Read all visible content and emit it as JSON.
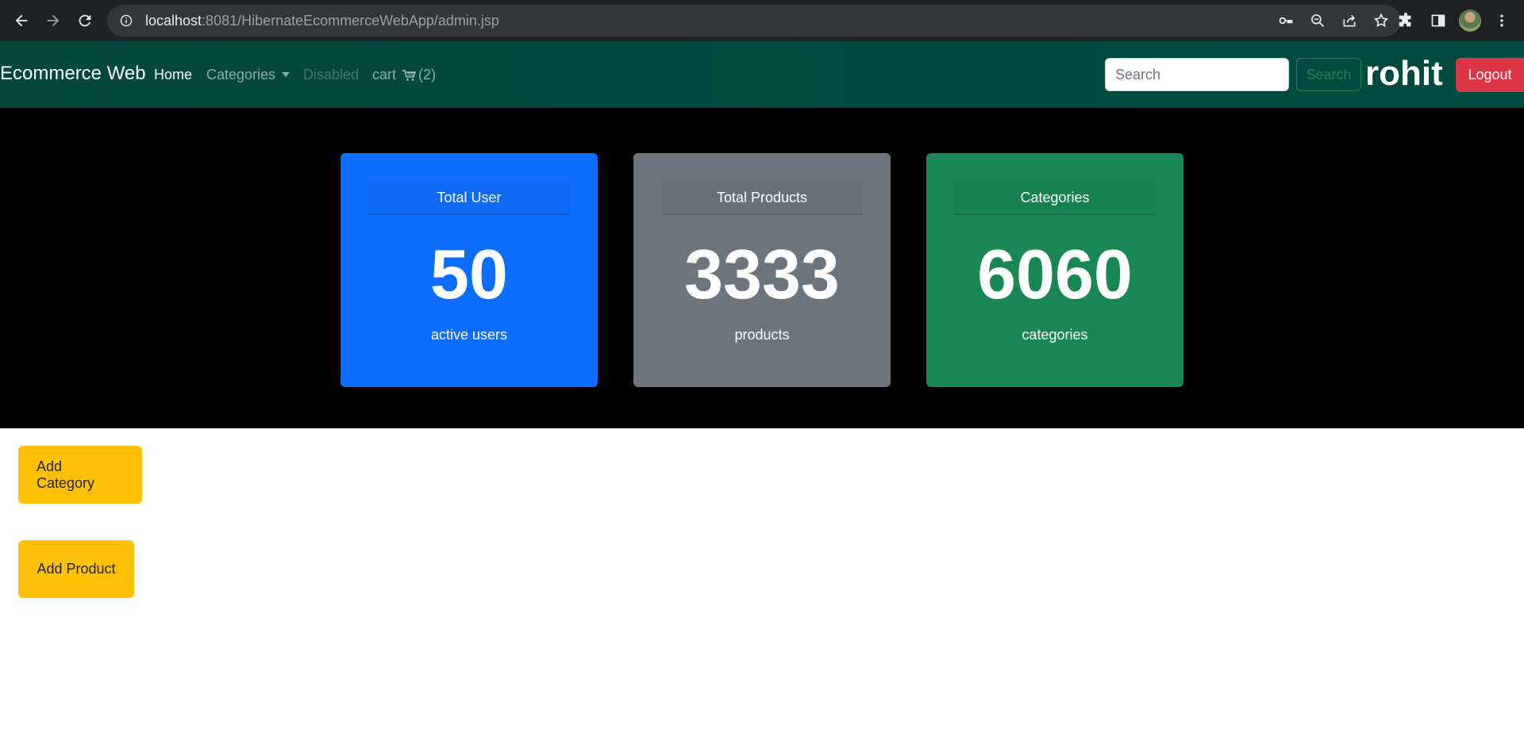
{
  "browser": {
    "url_host": "localhost",
    "url_rest": ":8081/HibernateEcommerceWebApp/admin.jsp"
  },
  "navbar": {
    "brand": "Ecommerce Web",
    "links": {
      "home": "Home",
      "categories": "Categories",
      "disabled": "Disabled",
      "cart": "cart",
      "cart_count": "(2)"
    },
    "search_placeholder": "Search",
    "search_button": "Search",
    "user_name": "rohit",
    "logout_button": "Logout"
  },
  "stats": [
    {
      "title": "Total User",
      "value": "50",
      "subtitle": "active users",
      "color": "#0d6efd"
    },
    {
      "title": "Total Products",
      "value": "3333",
      "subtitle": "products",
      "color": "#6c757d"
    },
    {
      "title": "Categories",
      "value": "6060",
      "subtitle": "categories",
      "color": "#198754"
    }
  ],
  "actions": {
    "add_category": "Add Category",
    "add_product": "Add Product"
  }
}
